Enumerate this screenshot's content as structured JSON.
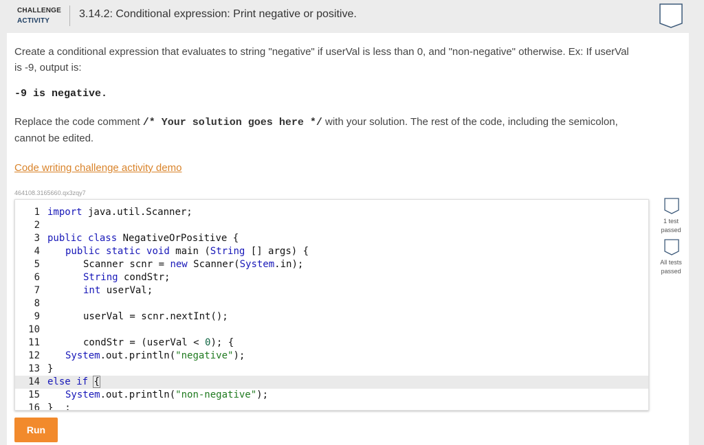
{
  "header": {
    "activity_label_line1": "CHALLENGE",
    "activity_label_line2": "ACTIVITY",
    "title": "3.14.2: Conditional expression: Print negative or positive."
  },
  "instructions": {
    "paragraph1": "Create a conditional expression that evaluates to string \"negative\" if userVal is less than 0, and \"non-negative\" otherwise. Ex: If userVal is -9, output is:",
    "example_output": "-9 is negative.",
    "paragraph2_before": "Replace the code comment ",
    "paragraph2_code": "/* Your solution goes here */",
    "paragraph2_after": " with your solution. The rest of the code, including the semicolon, cannot be edited.",
    "demo_link": "Code writing challenge activity demo",
    "code_id": "464108.3165660.qx3zqy7"
  },
  "editor": {
    "lines": [
      {
        "n": "1"
      },
      {
        "n": "2"
      },
      {
        "n": "3"
      },
      {
        "n": "4"
      },
      {
        "n": "5"
      },
      {
        "n": "6"
      },
      {
        "n": "7"
      },
      {
        "n": "8"
      },
      {
        "n": "9"
      },
      {
        "n": "10"
      },
      {
        "n": "11"
      },
      {
        "n": "12"
      },
      {
        "n": "13"
      },
      {
        "n": "14"
      },
      {
        "n": "15"
      },
      {
        "n": "16"
      }
    ],
    "code": {
      "l1a": "import",
      "l1b": " java.util.Scanner;",
      "l3a": "public",
      "l3b": "class",
      "l3c": " NegativeOrPositive {",
      "l4a": "public",
      "l4b": "static",
      "l4c": "void",
      "l4d": " main (",
      "l4e": "String",
      "l4f": " [] args) {",
      "l5a": "Scanner scnr = ",
      "l5b": "new",
      "l5c": " Scanner(",
      "l5d": "System",
      "l5e": ".in);",
      "l6a": "String",
      "l6b": " condStr;",
      "l7a": "int",
      "l7b": " userVal;",
      "l9": "userVal = scnr.nextInt();",
      "l11a": "condStr = (userVal < ",
      "l11b": "0",
      "l11c": "); {",
      "l12a": "System",
      "l12b": ".out.println(",
      "l12c": "\"negative\"",
      "l12d": ");",
      "l13": "}",
      "l14a": "else",
      "l14b": "if",
      "l14c": "{",
      "l15a": "System",
      "l15b": ".out.println(",
      "l15c": "\"non-negative\"",
      "l15d": ");",
      "l16": "}  ;"
    }
  },
  "tests": {
    "test1_label": "1 test passed",
    "test2_label": "All tests passed"
  },
  "run_button": "Run",
  "colors": {
    "accent": "#f28a2c",
    "link": "#d9832a",
    "keyword": "#1717b8",
    "string": "#1f7a1f"
  }
}
